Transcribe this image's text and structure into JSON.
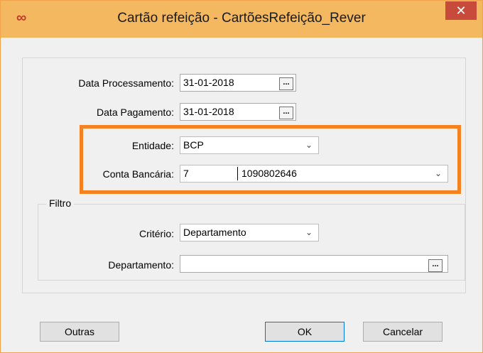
{
  "window": {
    "icon": "infinity-icon",
    "title": "Cartão refeição - CartõesRefeição_Rever",
    "close_symbol": "✕"
  },
  "form": {
    "data_processamento": {
      "label": "Data Processamento:",
      "value": "31-01-2018"
    },
    "data_pagamento": {
      "label": "Data Pagamento:",
      "value": "31-01-2018"
    },
    "entidade": {
      "label": "Entidade:",
      "value": "BCP"
    },
    "conta_bancaria": {
      "label": "Conta Bancária:",
      "code": "7",
      "number": "1090802646"
    },
    "ellipsis_label": "..."
  },
  "filtro": {
    "legend": "Filtro",
    "criterio": {
      "label": "Critério:",
      "value": "Departamento"
    },
    "departamento": {
      "label": "Departamento:",
      "value": ""
    }
  },
  "buttons": {
    "outras": "Outras",
    "ok": "OK",
    "cancelar": "Cancelar"
  },
  "colors": {
    "highlight": "#f58220",
    "titlebar": "#f3b860",
    "close": "#c74a3a"
  }
}
